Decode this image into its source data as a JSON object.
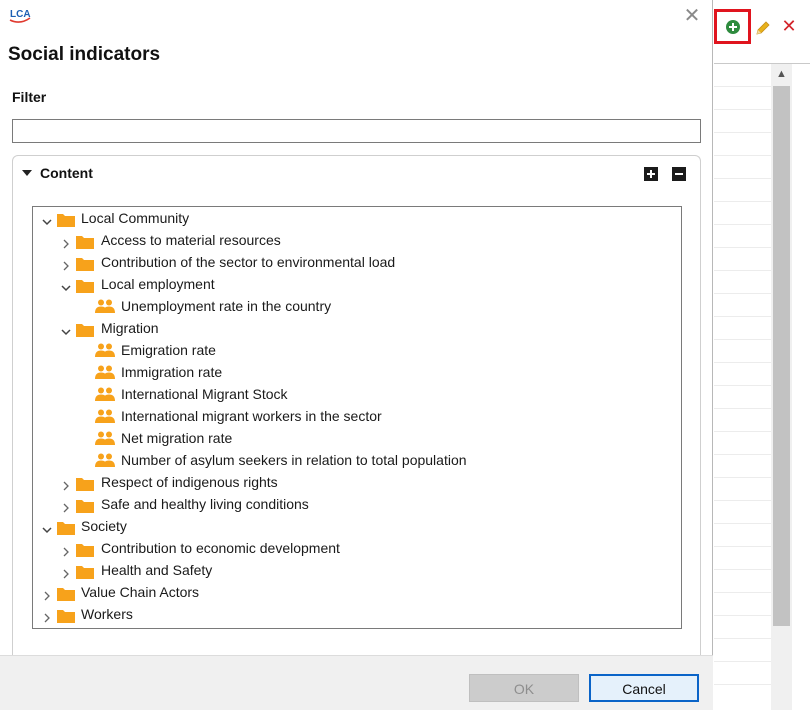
{
  "app": {
    "logo_text": "LCA",
    "logo_icon": "openlca-logo-icon"
  },
  "dialog": {
    "title": "Social indicators",
    "close_icon": "close-icon",
    "filter": {
      "label": "Filter",
      "value": "",
      "placeholder": ""
    },
    "content": {
      "label": "Content",
      "expand_icon": "expand-all-icon",
      "collapse_icon": "collapse-all-icon"
    },
    "buttons": {
      "ok": "OK",
      "cancel": "Cancel",
      "ok_enabled": false
    }
  },
  "tree": [
    {
      "label": "Local Community",
      "level": 0,
      "type": "folder",
      "expanded": true
    },
    {
      "label": "Access to material resources",
      "level": 1,
      "type": "folder",
      "expanded": false
    },
    {
      "label": "Contribution of the sector to environmental load",
      "level": 1,
      "type": "folder",
      "expanded": false
    },
    {
      "label": "Local employment",
      "level": 1,
      "type": "folder",
      "expanded": true
    },
    {
      "label": "Unemployment rate in the country",
      "level": 2,
      "type": "indicator"
    },
    {
      "label": "Migration",
      "level": 1,
      "type": "folder",
      "expanded": true
    },
    {
      "label": "Emigration rate",
      "level": 2,
      "type": "indicator"
    },
    {
      "label": "Immigration rate",
      "level": 2,
      "type": "indicator"
    },
    {
      "label": "International Migrant Stock",
      "level": 2,
      "type": "indicator"
    },
    {
      "label": "International migrant workers in the sector",
      "level": 2,
      "type": "indicator"
    },
    {
      "label": "Net migration rate",
      "level": 2,
      "type": "indicator"
    },
    {
      "label": "Number of asylum seekers in relation to total population",
      "level": 2,
      "type": "indicator"
    },
    {
      "label": "Respect of indigenous rights",
      "level": 1,
      "type": "folder",
      "expanded": false
    },
    {
      "label": "Safe and healthy living conditions",
      "level": 1,
      "type": "folder",
      "expanded": false
    },
    {
      "label": "Society",
      "level": 0,
      "type": "folder",
      "expanded": true
    },
    {
      "label": "Contribution to economic development",
      "level": 1,
      "type": "folder",
      "expanded": false
    },
    {
      "label": "Health and Safety",
      "level": 1,
      "type": "folder",
      "expanded": false
    },
    {
      "label": "Value Chain Actors",
      "level": 0,
      "type": "folder",
      "expanded": false
    },
    {
      "label": "Workers",
      "level": 0,
      "type": "folder",
      "expanded": false
    }
  ],
  "background_editor": {
    "toolbar": {
      "add_icon": "add-icon",
      "edit_icon": "edit-icon",
      "delete_icon": "delete-icon",
      "add_highlighted": true
    }
  },
  "colors": {
    "folder": "#f7a21b",
    "indicator": "#f7a21b",
    "highlight": "#e0141e",
    "add_green": "#2e8b3e",
    "delete_red": "#d3242b",
    "edit_yellow": "#e8b21b",
    "focus_blue": "#0a64c8"
  }
}
